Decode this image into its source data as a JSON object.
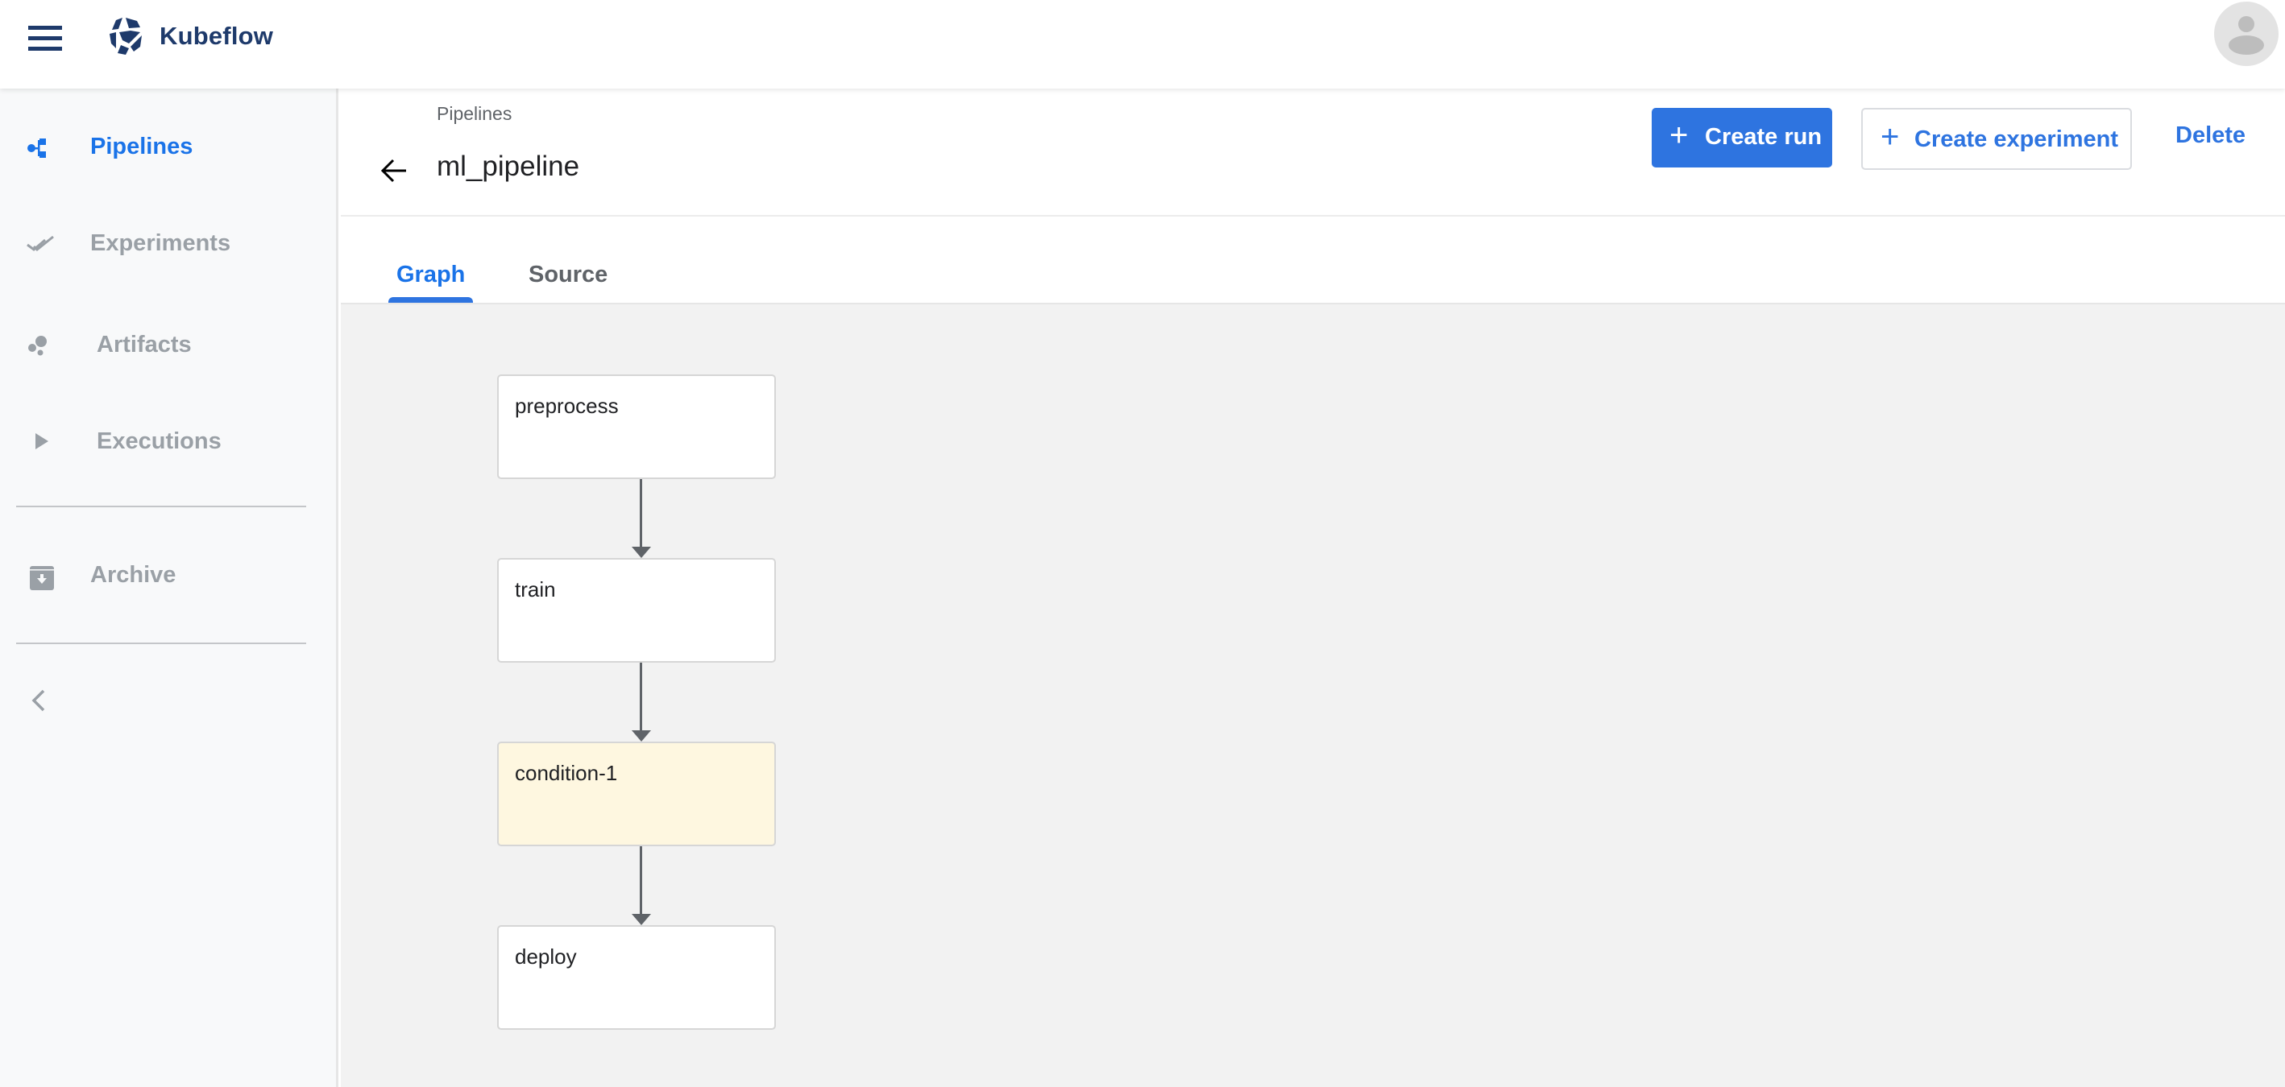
{
  "app": {
    "brand": "Kubeflow",
    "menu_icon": "hamburger-menu-icon",
    "logo_icon": "kubeflow-logo-icon",
    "avatar_icon": "account-avatar-icon"
  },
  "sidebar": {
    "items": [
      {
        "label": "Pipelines",
        "icon": "pipelines-icon",
        "active": true
      },
      {
        "label": "Experiments",
        "icon": "double-check-icon",
        "active": false
      },
      {
        "label": "Artifacts",
        "icon": "bubbles-icon",
        "active": false
      },
      {
        "label": "Executions",
        "icon": "play-icon",
        "active": false
      },
      {
        "label": "Archive",
        "icon": "archive-icon",
        "active": false
      }
    ],
    "collapse_icon": "chevron-left-icon"
  },
  "page": {
    "breadcrumb": "Pipelines",
    "title": "ml_pipeline",
    "back_icon": "arrow-back-icon"
  },
  "toolbar": {
    "create_run_label": "Create run",
    "create_experiment_label": "Create experiment",
    "delete_label": "Delete",
    "plus_glyph": "+"
  },
  "tabs": [
    {
      "label": "Graph",
      "active": true
    },
    {
      "label": "Source",
      "active": false
    }
  ],
  "graph": {
    "nodes": [
      {
        "label": "preprocess",
        "type": "task"
      },
      {
        "label": "train",
        "type": "task"
      },
      {
        "label": "condition-1",
        "type": "condition"
      },
      {
        "label": "deploy",
        "type": "task"
      }
    ],
    "edges": [
      {
        "from": "preprocess",
        "to": "train"
      },
      {
        "from": "train",
        "to": "condition-1"
      },
      {
        "from": "condition-1",
        "to": "deploy"
      }
    ]
  },
  "colors": {
    "accent": "#2e74e0",
    "brand": "#1e3a6b",
    "condition_node": "#fef7e0"
  }
}
